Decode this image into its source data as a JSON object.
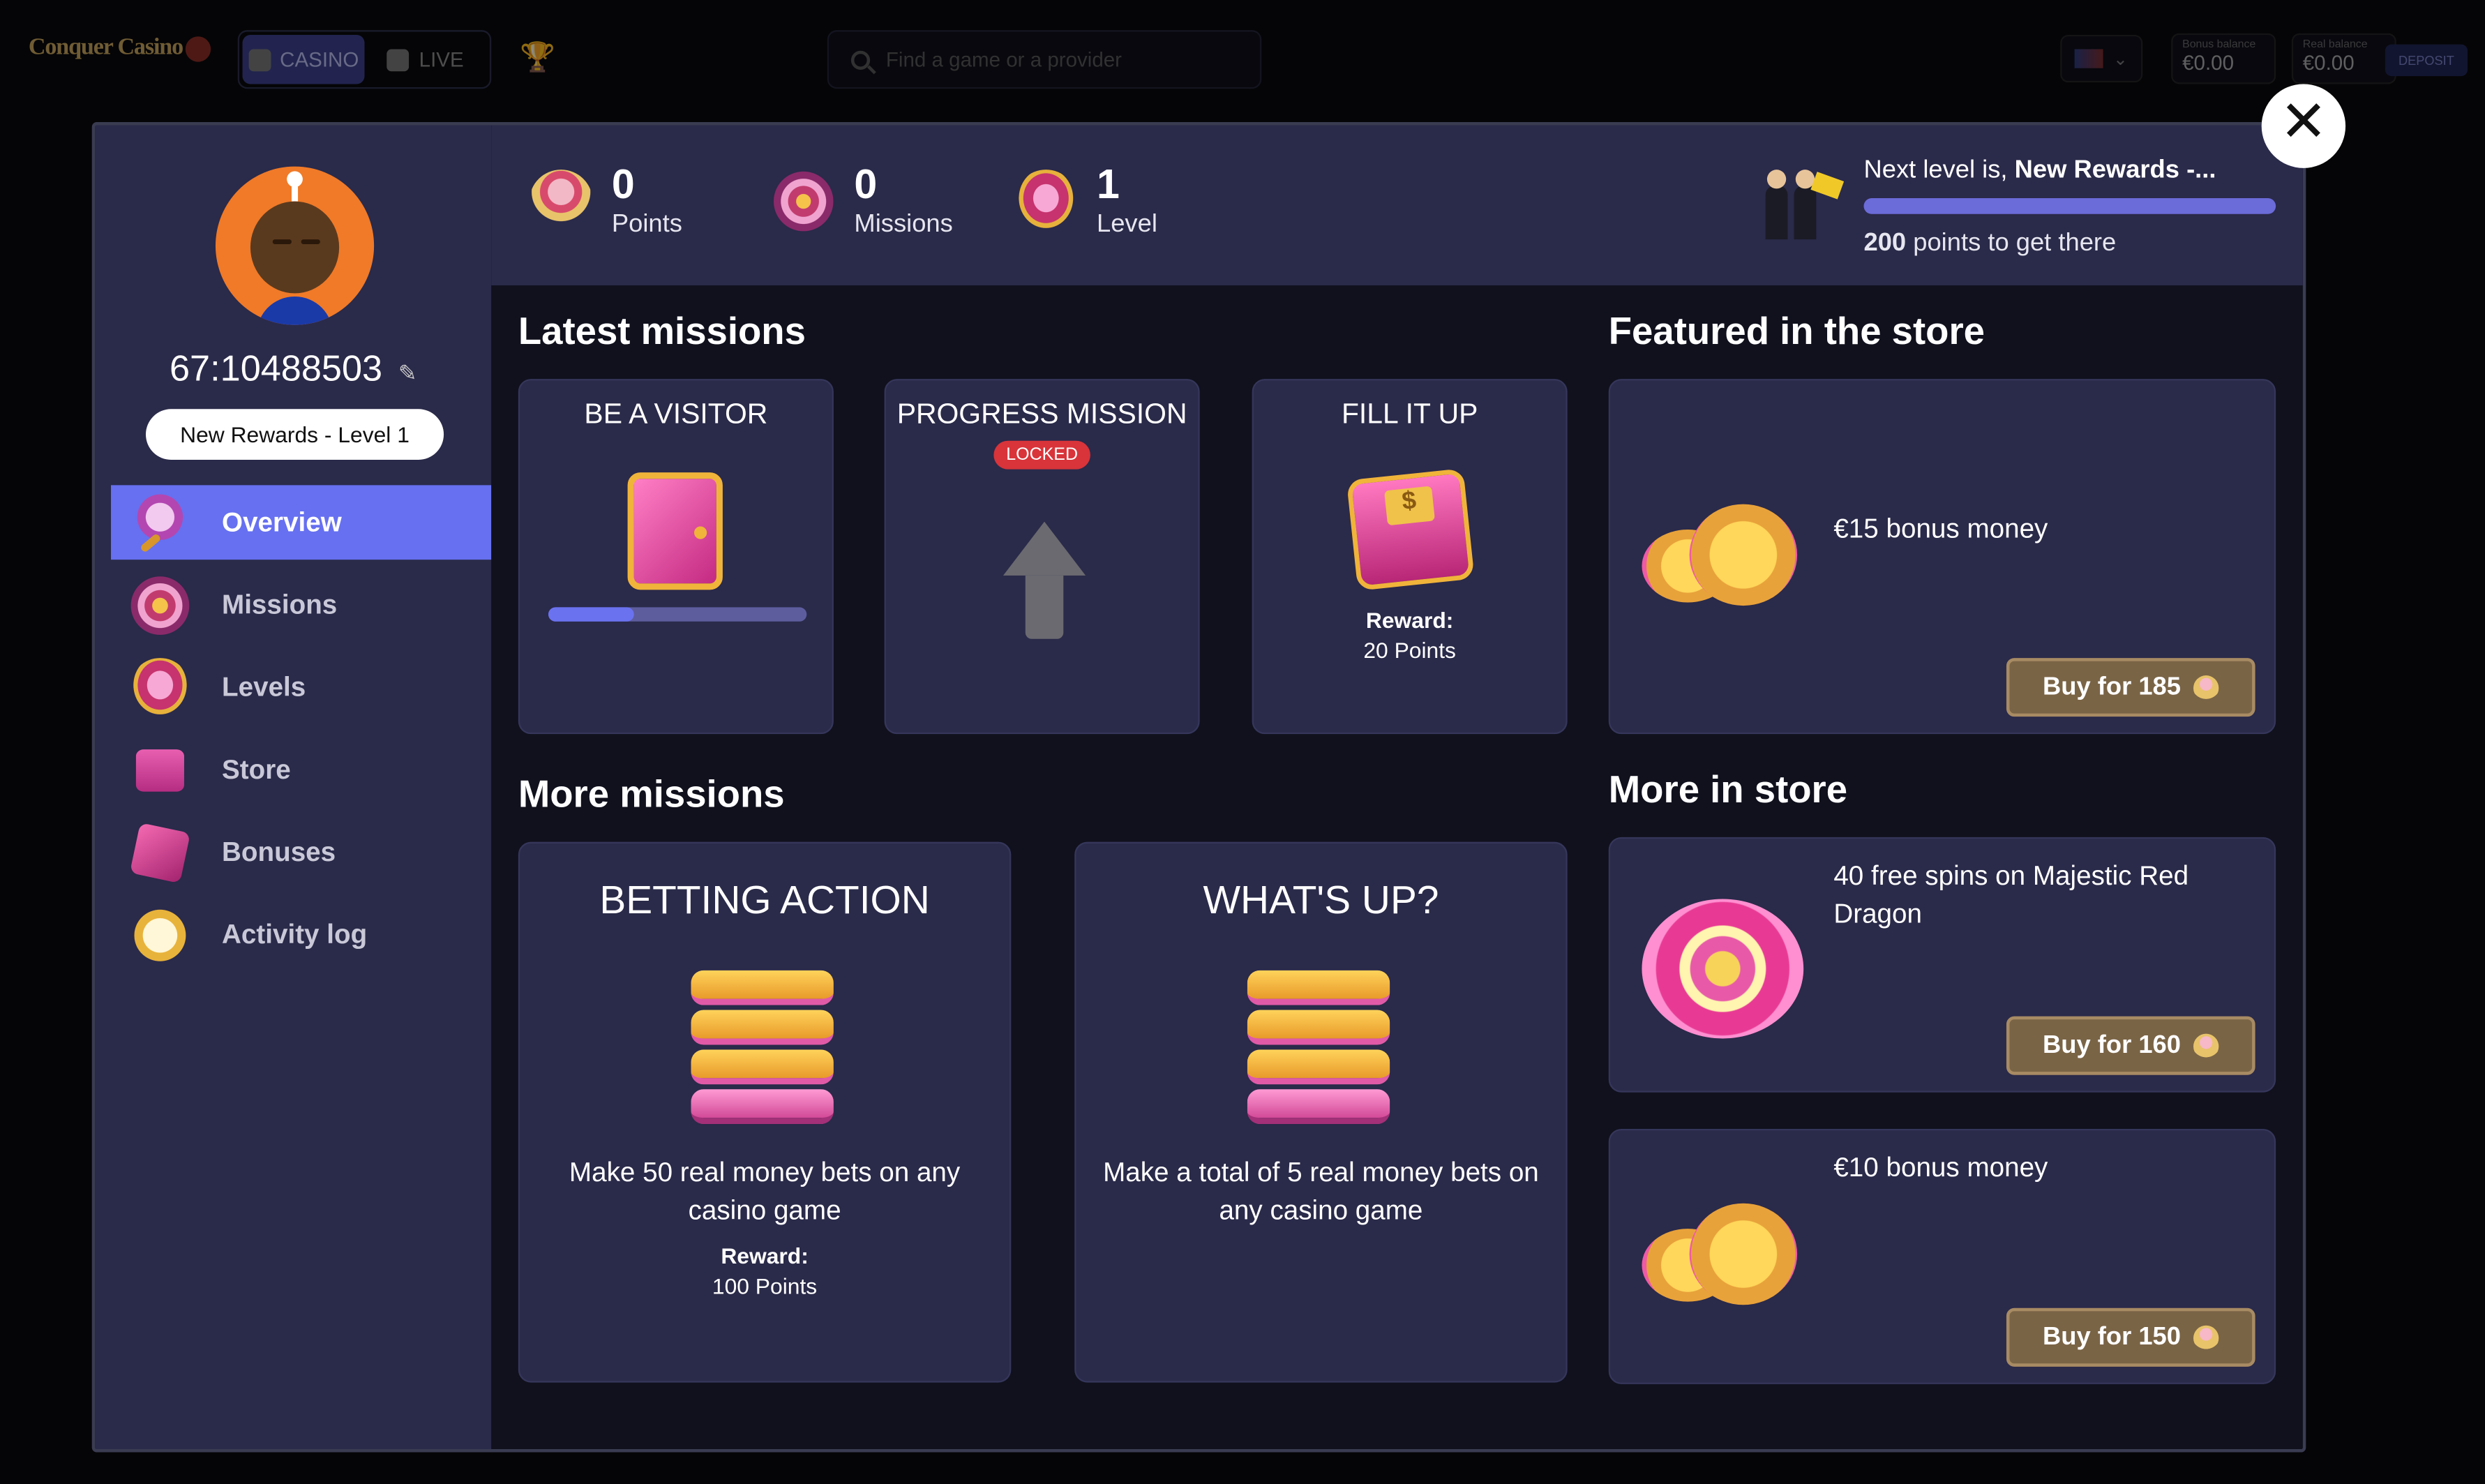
{
  "topbar": {
    "logo_text": "Conquer Casino",
    "tabs": [
      {
        "label": "CASINO",
        "icon": "dice-icon"
      },
      {
        "label": "LIVE",
        "icon": "cards-icon"
      }
    ],
    "trophy_icon": "trophy-icon",
    "search_placeholder": "Find a game or a provider",
    "language": "flag-uk",
    "bonus_balance_label": "Bonus balance",
    "bonus_balance": "€0.00",
    "real_balance_label": "Real balance",
    "real_balance": "€0.00",
    "deposit_label": "DEPOSIT"
  },
  "profile": {
    "user_id": "67:10488503",
    "level_pill": "New Rewards - Level 1"
  },
  "menu": [
    {
      "label": "Overview",
      "icon": "magnifier-icon",
      "active": true
    },
    {
      "label": "Missions",
      "icon": "target-icon",
      "active": false
    },
    {
      "label": "Levels",
      "icon": "shield-heart-icon",
      "active": false
    },
    {
      "label": "Store",
      "icon": "cart-icon",
      "active": false
    },
    {
      "label": "Bonuses",
      "icon": "gift-icon",
      "active": false
    },
    {
      "label": "Activity log",
      "icon": "stopwatch-icon",
      "active": false
    }
  ],
  "stats": {
    "points_value": "0",
    "points_label": "Points",
    "missions_value": "0",
    "missions_label": "Missions",
    "level_value": "1",
    "level_label": "Level"
  },
  "next_level": {
    "prefix": "Next level is, ",
    "name": "New Rewards -...",
    "points_bold": "200",
    "points_rest": " points to get there"
  },
  "latest_missions": {
    "title": "Latest missions",
    "cards": [
      {
        "title": "BE A VISITOR",
        "progress": 0.33
      },
      {
        "title": "PROGRESS MISSION",
        "badge": "LOCKED"
      },
      {
        "title": "FILL IT UP",
        "reward_label": "Reward:",
        "reward_value": "20 Points"
      }
    ]
  },
  "more_missions": {
    "title": "More missions",
    "cards": [
      {
        "title": "BETTING ACTION",
        "description": "Make 50 real money bets on any casino game",
        "reward_label": "Reward:",
        "reward_value": "100 Points"
      },
      {
        "title": "WHAT'S UP?",
        "description": "Make a total of 5 real money bets on any casino game"
      }
    ]
  },
  "featured_store": {
    "title": "Featured in the store",
    "item": {
      "text": "€15 bonus money",
      "button": "Buy for 185"
    }
  },
  "more_store": {
    "title": "More in store",
    "items": [
      {
        "text": "40 free spins on Majestic Red Dragon",
        "button": "Buy for 160"
      },
      {
        "text": "€10 bonus money",
        "button": "Buy for 150"
      }
    ]
  },
  "colors": {
    "accent": "#6670f0",
    "panel": "#2a2a4a",
    "locked": "#d8343a",
    "buy_button": "#7a6446"
  }
}
